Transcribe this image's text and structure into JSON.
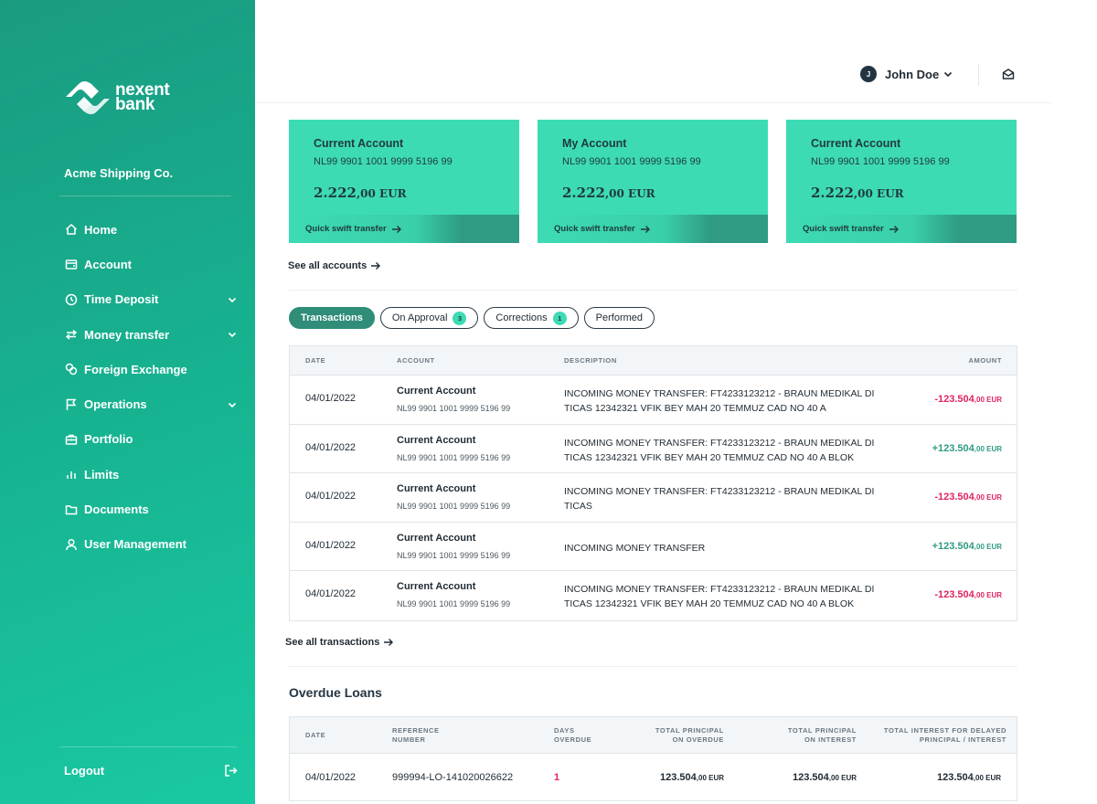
{
  "brand": {
    "line1": "nexent",
    "line2": "bank"
  },
  "sidebar": {
    "company": "Acme Shipping Co.",
    "items": [
      {
        "label": "Home",
        "icon": "home-icon",
        "chevron": false
      },
      {
        "label": "Account",
        "icon": "wallet-icon",
        "chevron": false
      },
      {
        "label": "Time Deposit",
        "icon": "clock-icon",
        "chevron": true
      },
      {
        "label": "Money transfer",
        "icon": "transfer-icon",
        "chevron": true
      },
      {
        "label": "Foreign Exchange",
        "icon": "exchange-icon",
        "chevron": false
      },
      {
        "label": "Operations",
        "icon": "flag-icon",
        "chevron": true
      },
      {
        "label": "Portfolio",
        "icon": "briefcase-icon",
        "chevron": false
      },
      {
        "label": "Limits",
        "icon": "bar-chart-icon",
        "chevron": false
      },
      {
        "label": "Documents",
        "icon": "folder-icon",
        "chevron": false
      },
      {
        "label": "User Management",
        "icon": "user-icon",
        "chevron": false
      }
    ],
    "logout": "Logout"
  },
  "header": {
    "user_initial": "J",
    "user_name": "John Doe"
  },
  "cards": [
    {
      "title": "Current Account",
      "iban": "NL99 9901 1001 9999 5196 99",
      "balance_int": "2.222",
      "balance_dec": ",00",
      "currency": " EUR",
      "action": "Quick swift transfer"
    },
    {
      "title": "My Account",
      "iban": "NL99 9901 1001 9999 5196 99",
      "balance_int": "2.222",
      "balance_dec": ",00",
      "currency": " EUR",
      "action": "Quick swift transfer"
    },
    {
      "title": "Current Account",
      "iban": "NL99 9901 1001 9999 5196 99",
      "balance_int": "2.222",
      "balance_dec": ",00",
      "currency": " EUR",
      "action": "Quick swift transfer"
    }
  ],
  "links": {
    "see_accounts": "See all accounts",
    "see_transactions": "See all transactions"
  },
  "tabs": [
    {
      "label": "Transactions",
      "badge": ""
    },
    {
      "label": "On Approval",
      "badge": "3"
    },
    {
      "label": "Corrections",
      "badge": "1"
    },
    {
      "label": "Performed",
      "badge": ""
    }
  ],
  "transactions": {
    "headers": {
      "date": "DATE",
      "account": "ACCOUNT",
      "description": "DESCRIPTION",
      "amount": "AMOUNT"
    },
    "rows": [
      {
        "date": "04/01/2022",
        "account": "Current Account",
        "iban": "NL99 9901 1001 9999 5196 99",
        "desc1": "INCOMING MONEY TRANSFER: FT4233123212 - BRAUN MEDIKAL DI",
        "desc2": "TICAS 12342321 VFIK BEY MAH 20 TEMMUZ CAD NO 40  A",
        "amount": "-123.504",
        "amount_dec": ",00 EUR",
        "sign": "neg"
      },
      {
        "date": "04/01/2022",
        "account": "Current Account",
        "iban": "NL99 9901 1001 9999 5196 99",
        "desc1": "INCOMING MONEY TRANSFER: FT4233123212 - BRAUN MEDIKAL DI",
        "desc2": "TICAS 12342321 VFIK BEY MAH 20 TEMMUZ CAD NO 40  A BLOK",
        "amount": "+123.504",
        "amount_dec": ",00 EUR",
        "sign": "pos"
      },
      {
        "date": "04/01/2022",
        "account": "Current Account",
        "iban": "NL99 9901 1001 9999 5196 99",
        "desc1": "INCOMING MONEY TRANSFER: FT4233123212 - BRAUN MEDIKAL DI",
        "desc2": "TICAS",
        "amount": "-123.504",
        "amount_dec": ",00 EUR",
        "sign": "neg"
      },
      {
        "date": "04/01/2022",
        "account": "Current Account",
        "iban": "NL99 9901 1001 9999 5196 99",
        "desc1": "INCOMING MONEY TRANSFER",
        "desc2": "",
        "amount": "+123.504",
        "amount_dec": ",00 EUR",
        "sign": "pos"
      },
      {
        "date": "04/01/2022",
        "account": "Current Account",
        "iban": "NL99 9901 1001 9999 5196 99",
        "desc1": "INCOMING MONEY TRANSFER: FT4233123212 - BRAUN MEDIKAL DI",
        "desc2": "TICAS 12342321 VFIK BEY MAH 20 TEMMUZ CAD NO 40  A BLOK",
        "amount": "-123.504",
        "amount_dec": ",00 EUR",
        "sign": "neg"
      }
    ]
  },
  "overdue": {
    "title": "Overdue Loans",
    "headers": {
      "date": "DATE",
      "ref1": "REFERENCE",
      "ref2": "NUMBER",
      "days1": "DAYS",
      "days2": "OVERDUE",
      "tpo1": "TOTAL PRINCIPAL",
      "tpo2": "ON OVERDUE",
      "tpi1": "TOTAL PRINCIPAL",
      "tpi2": "ON INTEREST",
      "tid1": "TOTAL INTEREST FOR DELAYED",
      "tid2": "PRINCIPAL / INTEREST"
    },
    "rows": [
      {
        "date": "04/01/2022",
        "ref": "999994-LO-141020026622",
        "days": "1",
        "tpo": "123.504",
        "tpo_cur": ",00 EUR",
        "tpi": "123.504",
        "tpi_cur": ",00 EUR",
        "tid": "123.504",
        "tid_cur": ",00 EUR"
      }
    ]
  },
  "colors": {
    "accent": "#3ddbb4",
    "sidebar": "#17b08f",
    "negative": "#e0245e",
    "positive": "#2f9b82"
  }
}
